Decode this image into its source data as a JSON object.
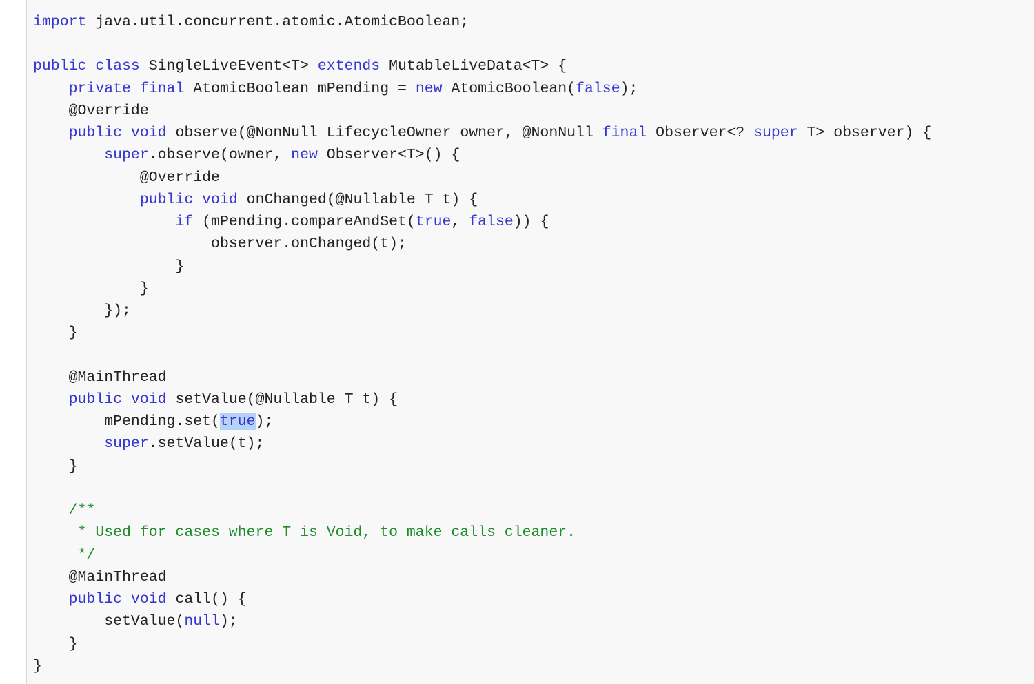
{
  "colors": {
    "keyword": "#3535d0",
    "comment": "#1f8c2a",
    "text": "#222222",
    "selection": "#b6d3f7",
    "background": "#f8f8f8"
  },
  "code": {
    "language": "java",
    "lines": [
      [
        [
          "import",
          "kw"
        ],
        [
          " java.util.concurrent.atomic.AtomicBoolean;",
          "p"
        ]
      ],
      [],
      [
        [
          "public",
          "kw"
        ],
        [
          " ",
          "p"
        ],
        [
          "class",
          "kw"
        ],
        [
          " SingleLiveEvent<T> ",
          "p"
        ],
        [
          "extends",
          "kw"
        ],
        [
          " MutableLiveData<T> {",
          "p"
        ]
      ],
      [
        [
          "    ",
          "p"
        ],
        [
          "private",
          "kw"
        ],
        [
          " ",
          "p"
        ],
        [
          "final",
          "kw"
        ],
        [
          " AtomicBoolean mPending = ",
          "p"
        ],
        [
          "new",
          "kw"
        ],
        [
          " AtomicBoolean(",
          "p"
        ],
        [
          "false",
          "kw"
        ],
        [
          ");",
          "p"
        ]
      ],
      [
        [
          "    @Override",
          "p"
        ]
      ],
      [
        [
          "    ",
          "p"
        ],
        [
          "public",
          "kw"
        ],
        [
          " ",
          "p"
        ],
        [
          "void",
          "kw"
        ],
        [
          " observe(@NonNull LifecycleOwner owner, @NonNull ",
          "p"
        ],
        [
          "final",
          "kw"
        ],
        [
          " Observer<? ",
          "p"
        ],
        [
          "super",
          "kw"
        ],
        [
          " T> observer) {",
          "p"
        ]
      ],
      [
        [
          "        ",
          "p"
        ],
        [
          "super",
          "kw"
        ],
        [
          ".observe(owner, ",
          "p"
        ],
        [
          "new",
          "kw"
        ],
        [
          " Observer<T>() {",
          "p"
        ]
      ],
      [
        [
          "            @Override",
          "p"
        ]
      ],
      [
        [
          "            ",
          "p"
        ],
        [
          "public",
          "kw"
        ],
        [
          " ",
          "p"
        ],
        [
          "void",
          "kw"
        ],
        [
          " onChanged(@Nullable T t) {",
          "p"
        ]
      ],
      [
        [
          "                ",
          "p"
        ],
        [
          "if",
          "kw"
        ],
        [
          " (mPending.compareAndSet(",
          "p"
        ],
        [
          "true",
          "kw"
        ],
        [
          ", ",
          "p"
        ],
        [
          "false",
          "kw"
        ],
        [
          ")) {",
          "p"
        ]
      ],
      [
        [
          "                    observer.onChanged(t);",
          "p"
        ]
      ],
      [
        [
          "                }",
          "p"
        ]
      ],
      [
        [
          "            }",
          "p"
        ]
      ],
      [
        [
          "        });",
          "p"
        ]
      ],
      [
        [
          "    }",
          "p"
        ]
      ],
      [],
      [
        [
          "    @MainThread",
          "p"
        ]
      ],
      [
        [
          "    ",
          "p"
        ],
        [
          "public",
          "kw"
        ],
        [
          " ",
          "p"
        ],
        [
          "void",
          "kw"
        ],
        [
          " setValue(@Nullable T t) {",
          "p"
        ]
      ],
      [
        [
          "        mPending.set(",
          "p"
        ],
        [
          "true",
          "hl"
        ],
        [
          ");",
          "p"
        ]
      ],
      [
        [
          "        ",
          "p"
        ],
        [
          "super",
          "kw"
        ],
        [
          ".setValue(t);",
          "p"
        ]
      ],
      [
        [
          "    }",
          "p"
        ]
      ],
      [],
      [
        [
          "    /**",
          "cm"
        ]
      ],
      [
        [
          "     * Used for cases where T is Void, to make calls cleaner.",
          "cm"
        ]
      ],
      [
        [
          "     */",
          "cm"
        ]
      ],
      [
        [
          "    @MainThread",
          "p"
        ]
      ],
      [
        [
          "    ",
          "p"
        ],
        [
          "public",
          "kw"
        ],
        [
          " ",
          "p"
        ],
        [
          "void",
          "kw"
        ],
        [
          " call() {",
          "p"
        ]
      ],
      [
        [
          "        setValue(",
          "p"
        ],
        [
          "null",
          "kw"
        ],
        [
          ");",
          "p"
        ]
      ],
      [
        [
          "    }",
          "p"
        ]
      ],
      [
        [
          "}",
          "p"
        ]
      ]
    ]
  }
}
